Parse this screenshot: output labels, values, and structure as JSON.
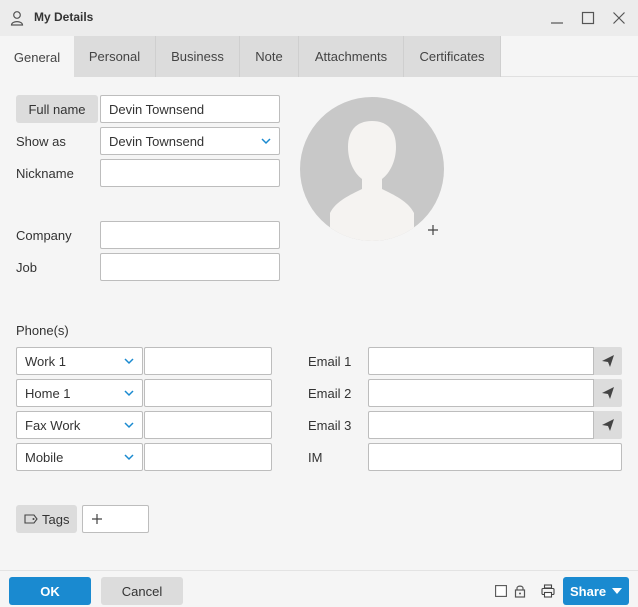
{
  "window": {
    "title": "My Details",
    "minimize_icon": "minimize-icon",
    "maximize_icon": "maximize-icon",
    "close_icon": "close-icon"
  },
  "tabs": [
    {
      "label": "General",
      "active": true
    },
    {
      "label": "Personal"
    },
    {
      "label": "Business"
    },
    {
      "label": "Note"
    },
    {
      "label": "Attachments"
    },
    {
      "label": "Certificates"
    }
  ],
  "general": {
    "full_name_button": "Full name",
    "full_name_value": "Devin Townsend",
    "show_as_label": "Show as",
    "show_as_value": "Devin Townsend",
    "nickname_label": "Nickname",
    "nickname_value": "",
    "company_label": "Company",
    "company_value": "",
    "job_label": "Job",
    "job_value": ""
  },
  "phones": {
    "section_label": "Phone(s)",
    "rows": [
      {
        "type": "Work 1",
        "value": ""
      },
      {
        "type": "Home 1",
        "value": ""
      },
      {
        "type": "Fax Work",
        "value": ""
      },
      {
        "type": "Mobile",
        "value": ""
      }
    ]
  },
  "emails": [
    {
      "label": "Email 1",
      "value": ""
    },
    {
      "label": "Email 2",
      "value": ""
    },
    {
      "label": "Email 3",
      "value": ""
    }
  ],
  "im": {
    "label": "IM",
    "value": ""
  },
  "tags": {
    "button_label": "Tags"
  },
  "footer": {
    "ok_label": "OK",
    "cancel_label": "Cancel",
    "share_label": "Share"
  },
  "colors": {
    "accent": "#1a8ad0",
    "button_gray": "#dcdcdc",
    "background": "#f5f5f5"
  }
}
